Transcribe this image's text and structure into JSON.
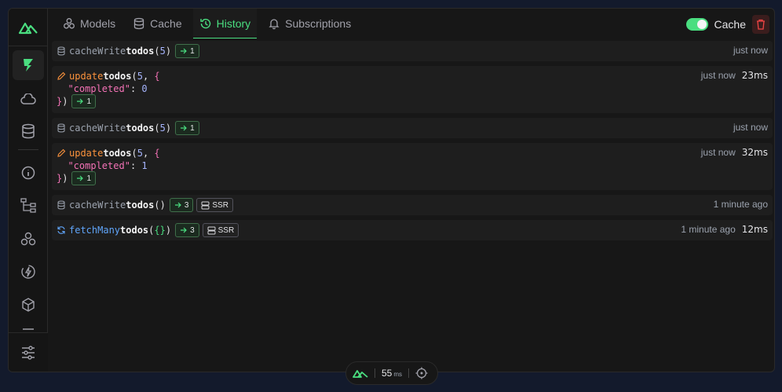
{
  "tabs": [
    {
      "label": "Models",
      "icon": "models-icon"
    },
    {
      "label": "Cache",
      "icon": "database-icon"
    },
    {
      "label": "History",
      "icon": "history-icon",
      "active": true
    },
    {
      "label": "Subscriptions",
      "icon": "bell-icon"
    }
  ],
  "top_right": {
    "cache_toggle_label": "Cache",
    "cache_enabled": true
  },
  "history": [
    {
      "op": "cacheWrite",
      "model": "todos",
      "args_text": "5",
      "badge": "1",
      "time": "just now",
      "duration": ""
    },
    {
      "op": "update",
      "model": "todos",
      "args_num": "5",
      "body_key": "\"completed\"",
      "body_val": "0",
      "badge": "1",
      "time": "just now",
      "duration": "23ms"
    },
    {
      "op": "cacheWrite",
      "model": "todos",
      "args_text": "5",
      "badge": "1",
      "time": "just now",
      "duration": ""
    },
    {
      "op": "update",
      "model": "todos",
      "args_num": "5",
      "body_key": "\"completed\"",
      "body_val": "1",
      "badge": "1",
      "time": "just now",
      "duration": "32ms"
    },
    {
      "op": "cacheWrite",
      "model": "todos",
      "args_text": "",
      "badge": "3",
      "ssr": "SSR",
      "time": "1 minute ago",
      "duration": ""
    },
    {
      "op": "fetchMany",
      "model": "todos",
      "args_text": "{}",
      "badge": "3",
      "ssr": "SSR",
      "time": "1 minute ago",
      "duration": "12ms"
    }
  ],
  "footer": {
    "value": "55",
    "unit": "ms"
  },
  "colors": {
    "accent": "#4ade80",
    "danger": "#ef4444",
    "bg": "#171717"
  }
}
